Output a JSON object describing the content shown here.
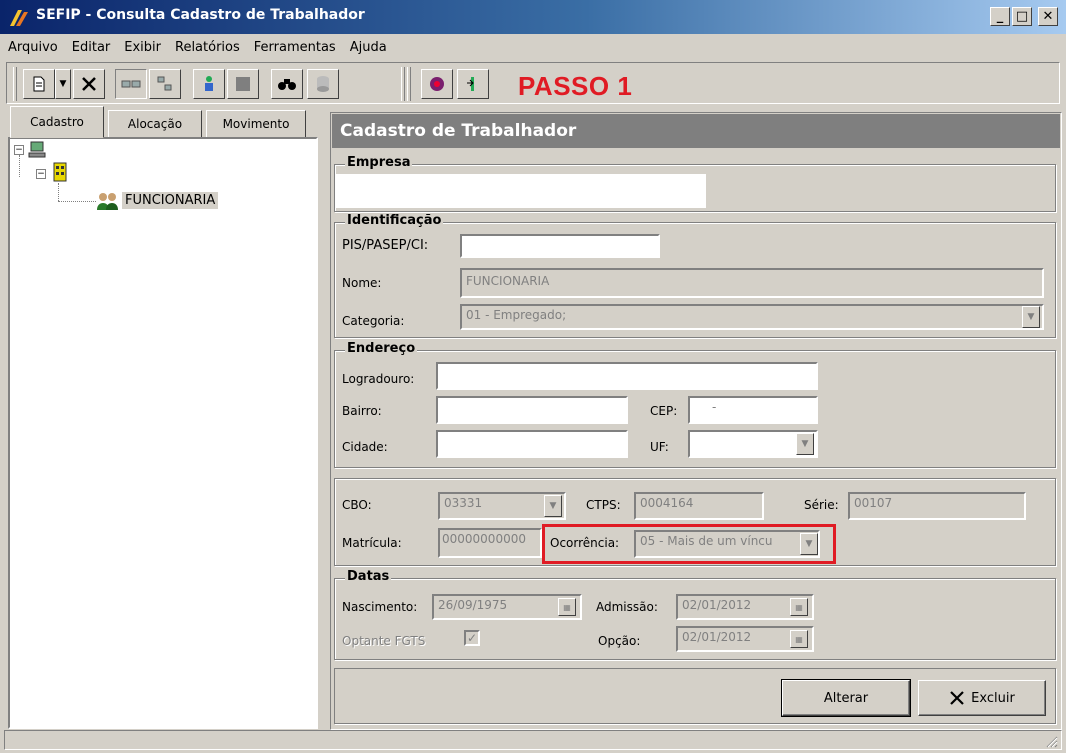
{
  "window": {
    "title": "SEFIP - Consulta Cadastro de Trabalhador",
    "min_glyph": "_",
    "max_glyph": "□",
    "close_glyph": "✕"
  },
  "menu": [
    "Arquivo",
    "Editar",
    "Exibir",
    "Relatórios",
    "Ferramentas",
    "Ajuda"
  ],
  "toolbar": {
    "annotation": "PASSO 1",
    "annotation_color": "#e01b24"
  },
  "tabs": [
    "Cadastro",
    "Alocação",
    "Movimento"
  ],
  "tree": {
    "leaf_label": "FUNCIONARIA"
  },
  "panel": {
    "header": "Cadastro de Trabalhador",
    "empresa": {
      "title": "Empresa",
      "value": ""
    },
    "identificacao": {
      "title": "Identificação",
      "pis_label": "PIS/PASEP/CI:",
      "pis_value": "",
      "nome_label": "Nome:",
      "nome_value": "FUNCIONARIA",
      "categoria_label": "Categoria:",
      "categoria_value": "01 - Empregado;"
    },
    "endereco": {
      "title": "Endereço",
      "logradouro_label": "Logradouro:",
      "logradouro_value": "",
      "bairro_label": "Bairro:",
      "bairro_value": "",
      "cep_label": "CEP:",
      "cep_value": "-",
      "cidade_label": "Cidade:",
      "cidade_value": "",
      "uf_label": "UF:",
      "uf_value": ""
    },
    "trabalho": {
      "cbo_label": "CBO:",
      "cbo_value": "03331",
      "ctps_label": "CTPS:",
      "ctps_value": "0004164",
      "serie_label": "Série:",
      "serie_value": "00107",
      "matricula_label": "Matrícula:",
      "matricula_value": "00000000000",
      "ocorrencia_label": "Ocorrência:",
      "ocorrencia_value": "05 - Mais de um víncu",
      "highlight_color": "#e01b24"
    },
    "datas": {
      "title": "Datas",
      "nascimento_label": "Nascimento:",
      "nascimento_value": "26/09/1975",
      "admissao_label": "Admissão:",
      "admissao_value": "02/01/2012",
      "optante_label": "Optante FGTS",
      "opcao_label": "Opção:",
      "opcao_value": "02/01/2012"
    },
    "buttons": {
      "alterar": "Alterar",
      "excluir": "Excluir"
    }
  }
}
